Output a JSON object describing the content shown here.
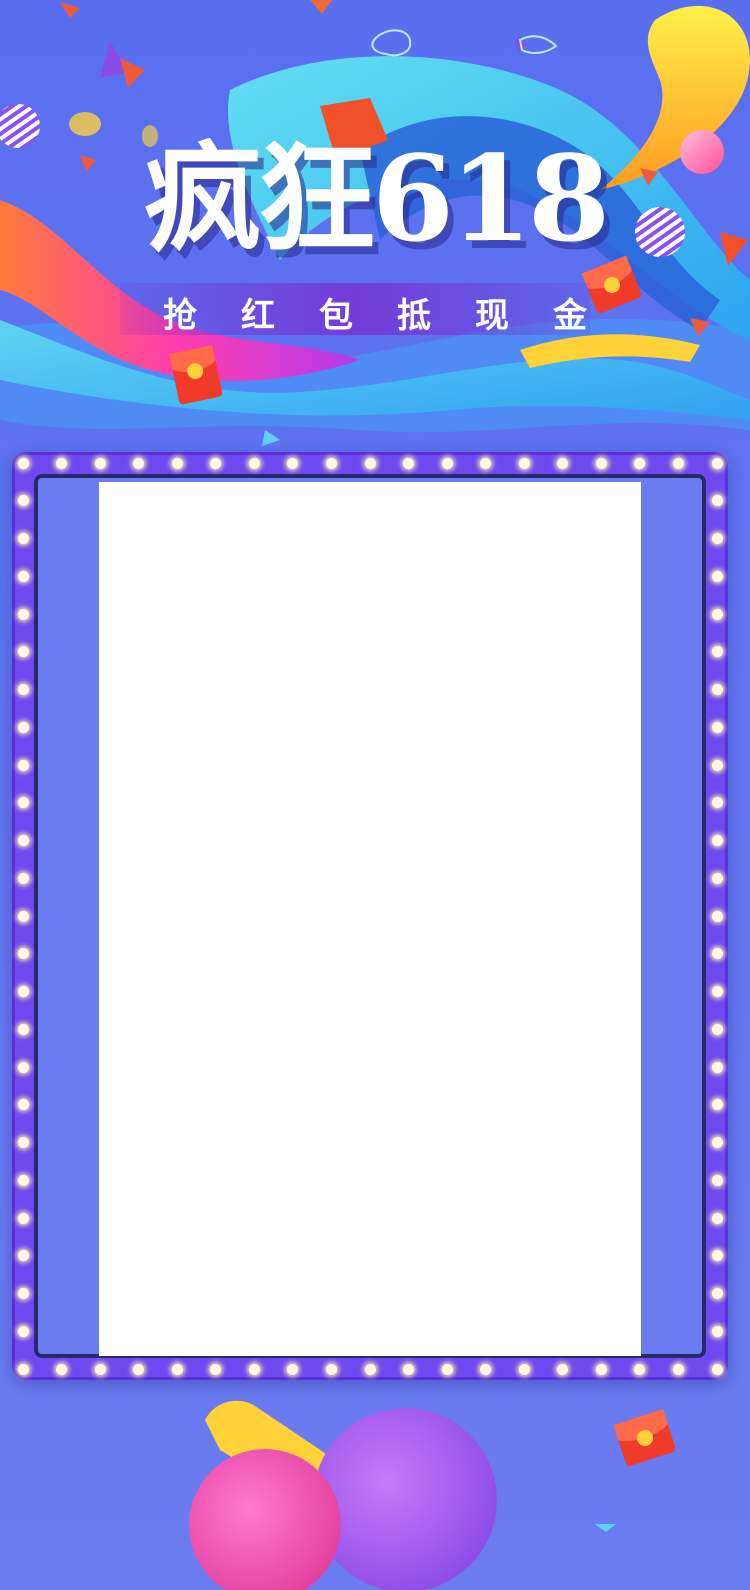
{
  "poster": {
    "title": "疯狂618",
    "subtitle": "抢红包抵现金"
  },
  "colors": {
    "background": "#6b7cf0",
    "frame": "#6f49f0",
    "frame_inner_border": "#262a6d",
    "bulb": "#fffbe3",
    "card": "#ffffff"
  },
  "icons": [
    "red-envelope-icon",
    "gold-coin-icon",
    "striped-ball-icon"
  ]
}
